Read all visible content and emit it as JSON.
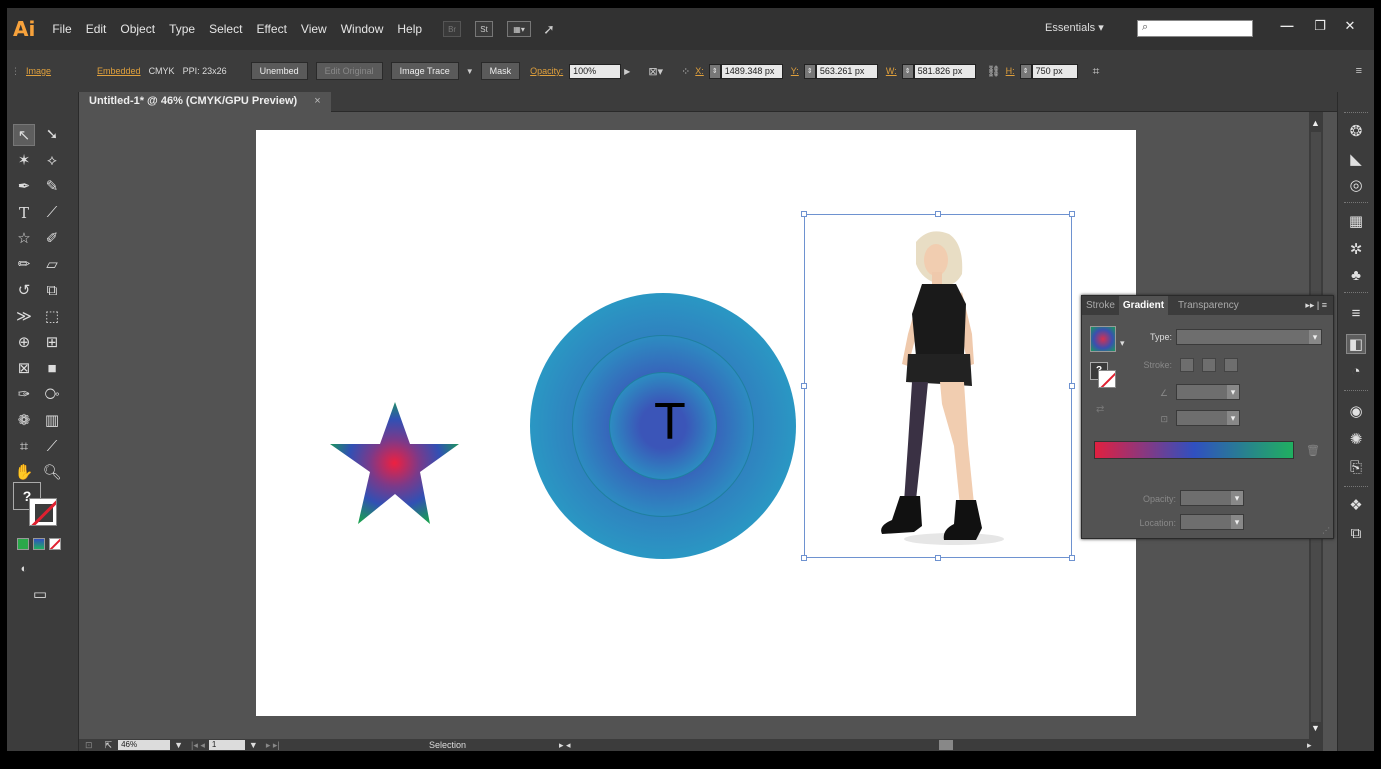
{
  "menu": {
    "logo": "Ai",
    "items": [
      "File",
      "Edit",
      "Object",
      "Type",
      "Select",
      "Effect",
      "View",
      "Window",
      "Help"
    ],
    "bridge_label": "Br",
    "stock_label": "St",
    "workspace": "Essentials",
    "workspace_arrow": "▾",
    "search_icon": "⌕",
    "minimize": "—",
    "restore": "❐",
    "close": "✕"
  },
  "control_bar": {
    "object_type": "Image",
    "embedded": "Embedded",
    "color_mode": "CMYK",
    "ppi": "PPI: 23x26",
    "unembed": "Unembed",
    "edit_original": "Edit Original",
    "image_trace": "Image Trace",
    "mask": "Mask",
    "opacity_label": "Opacity:",
    "opacity_value": "100%",
    "x_label": "X:",
    "x_value": "1489.348 px",
    "y_label": "Y:",
    "y_value": "563.261 px",
    "w_label": "W:",
    "w_value": "581.826 px",
    "h_label": "H:",
    "h_value": "750 px"
  },
  "document": {
    "tab_title": "Untitled-1* @ 46% (CMYK/GPU Preview)",
    "close": "×"
  },
  "status_bar": {
    "zoom": "46%",
    "artboard": "1",
    "current_tool": "Selection"
  },
  "gradient_panel": {
    "tabs": [
      "Stroke",
      "Gradient",
      "Transparency"
    ],
    "active_tab": "Gradient",
    "menu_icon": "▸▸ | ≡",
    "type_label": "Type:",
    "stroke_label": "Stroke:",
    "opacity_label": "Opacity:",
    "location_label": "Location:",
    "fill_question": "?"
  },
  "artwork": {
    "text_glyph": "T"
  },
  "colors": {
    "app_bg": "#535353",
    "panel_dark": "#3c3c3c",
    "accent_orange": "#e0a03c",
    "gradient_red": "#e02040",
    "gradient_blue": "#3050c0",
    "gradient_green": "#20b060",
    "selection_blue": "#6e92d0"
  }
}
